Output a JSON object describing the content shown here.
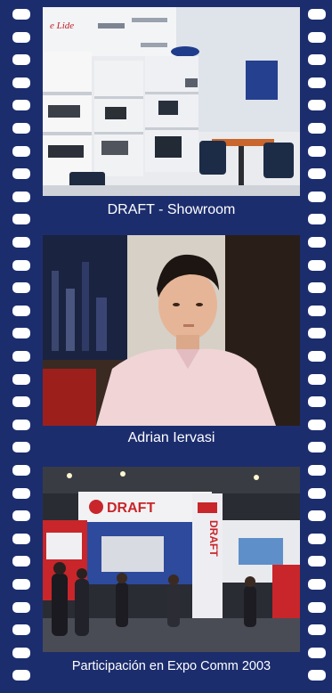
{
  "photos": [
    {
      "caption": "DRAFT - Showroom",
      "logo_text": "",
      "scene": "showroom"
    },
    {
      "caption": "Adrian Iervasi",
      "scene": "portrait"
    },
    {
      "caption": "Participación en Expo Comm 2003",
      "booth_logo": "DRAFT",
      "scene": "expo-booth"
    }
  ],
  "colors": {
    "film": "#1c2d6e",
    "holes": "#ffffff",
    "caption_text": "#ffffff"
  }
}
